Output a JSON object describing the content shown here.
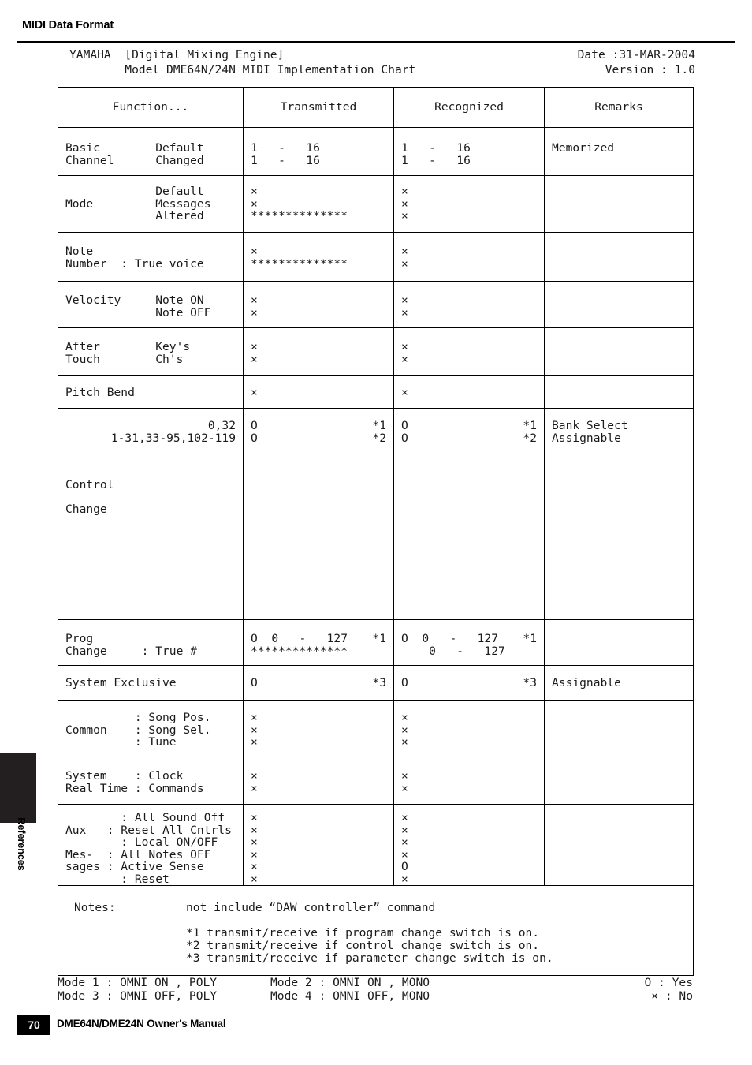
{
  "running_head": "MIDI Data Format",
  "side_tab": {
    "label": "References"
  },
  "footer": {
    "page_number": "70",
    "manual_title": "DME64N/DME24N Owner's Manual"
  },
  "chart_header": {
    "line1_left": "YAMAHA  [Digital Mixing Engine]",
    "line1_right": "Date :31-MAR-2004",
    "line2_left": "        Model DME64N/24N MIDI Implementation Chart",
    "line2_right": "Version : 1.0"
  },
  "columns": [
    "Function...",
    "Transmitted",
    "Recognized",
    "Remarks"
  ],
  "rows": [
    {
      "name": "basic-channel",
      "function": "Basic        Default\nChannel      Changed",
      "transmitted": "1   -   16\n1   -   16",
      "recognized": "1   -   16\n1   -   16",
      "remarks": "Memorized"
    },
    {
      "name": "mode",
      "function": "             Default\nMode         Messages\n             Altered",
      "transmitted": "×\n×\n**************",
      "recognized": "×\n×\n×",
      "remarks": ""
    },
    {
      "name": "note-number",
      "function": "Note\nNumber  : True voice",
      "transmitted": "×\n**************",
      "recognized": "×\n×",
      "remarks": ""
    },
    {
      "name": "velocity",
      "function": "Velocity     Note ON\n             Note OFF",
      "transmitted": "×\n×",
      "recognized": "×\n×",
      "remarks": ""
    },
    {
      "name": "after-touch",
      "function": "After        Key's\nTouch        Ch's",
      "transmitted": "×\n×",
      "recognized": "×\n×",
      "remarks": ""
    },
    {
      "name": "pitch-bend",
      "function": "Pitch Bend",
      "transmitted": "×",
      "recognized": "×",
      "remarks": ""
    },
    {
      "name": "control-change",
      "function_right": "0,32\n1-31,33-95,102-119",
      "function_lower": "Control\n\nChange",
      "transmitted_left": "O\nO",
      "transmitted_right": "*1\n*2",
      "recognized_left": "O\nO",
      "recognized_right": "*1\n*2",
      "remarks": "Bank Select\nAssignable"
    },
    {
      "name": "prog-change",
      "function": "Prog\nChange     : True #",
      "transmitted_left": "O  0   -   127\n**************",
      "transmitted_right": "*1\n",
      "recognized_left": "O  0   -   127\n    0   -   127",
      "recognized_right": "*1\n",
      "remarks": ""
    },
    {
      "name": "system-exclusive",
      "function": "System Exclusive",
      "transmitted_left": "O",
      "transmitted_right": "*3",
      "recognized_left": "O",
      "recognized_right": "*3",
      "remarks": "Assignable"
    },
    {
      "name": "common",
      "function": "          : Song Pos.\nCommon    : Song Sel.\n          : Tune",
      "transmitted": "×\n×\n×",
      "recognized": "×\n×\n×",
      "remarks": ""
    },
    {
      "name": "system-real-time",
      "function": "System    : Clock\nReal Time : Commands",
      "transmitted": "×\n×",
      "recognized": "×\n×",
      "remarks": ""
    },
    {
      "name": "aux-messages",
      "function": "        : All Sound Off\nAux   : Reset All Cntrls\n        : Local ON/OFF\nMes-  : All Notes OFF\nsages : Active Sense\n        : Reset",
      "transmitted": "×\n×\n×\n×\n×\n×",
      "recognized": "×\n×\n×\n×\nO\n×",
      "remarks": ""
    }
  ],
  "notes": {
    "label": "Notes:",
    "main": "not include “DAW controller” command",
    "items": [
      "*1 transmit/receive if program change switch is on.",
      "*2 transmit/receive if control change switch is on.",
      "*3 transmit/receive if parameter change switch is on."
    ]
  },
  "legend": {
    "row1_mode_a": "Mode 1 : OMNI ON , POLY",
    "row1_mode_b": "Mode 2 : OMNI ON , MONO",
    "row1_symbol": "O : Yes",
    "row2_mode_a": "Mode 3 : OMNI OFF, POLY",
    "row2_mode_b": "Mode 4 : OMNI OFF, MONO",
    "row2_symbol": "× : No"
  }
}
